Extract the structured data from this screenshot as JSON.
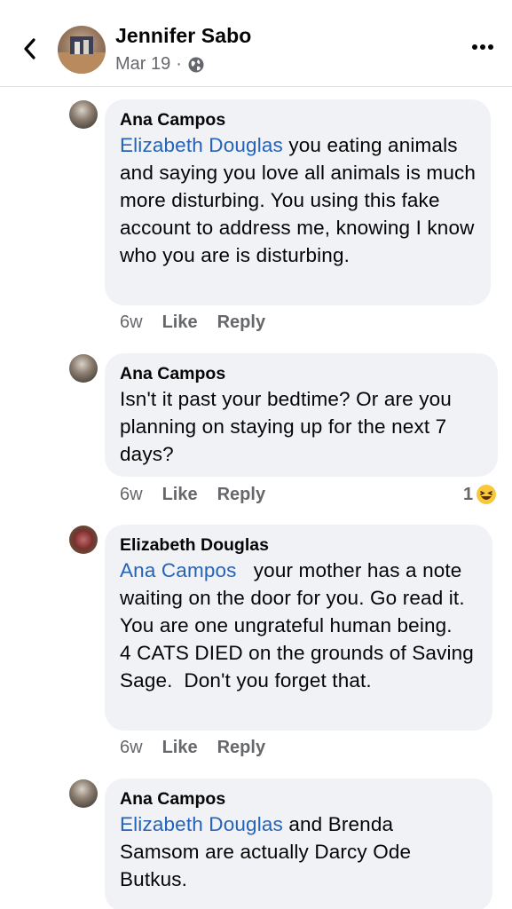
{
  "header": {
    "name": "Jennifer Sabo",
    "date": "Mar 19",
    "separator": "·"
  },
  "comments": [
    {
      "author": "Ana Campos",
      "mention": "Elizabeth Douglas",
      "text": " you eating animals and saying you love all animals is much more disturbing. You using this fake account to address me, knowing I know who you are is disturbing.",
      "time": "6w",
      "like": "Like",
      "reply": "Reply"
    },
    {
      "author": "Ana Campos",
      "mention": "",
      "text": "Isn't it past your bedtime? Or are you planning on staying up for the next 7 days?",
      "time": "6w",
      "like": "Like",
      "reply": "Reply",
      "reaction_count": "1"
    },
    {
      "author": "Elizabeth Douglas",
      "mention": "Ana Campos",
      "text": "   your mother has a note waiting on the door for you. Go read it.   You are one ungrateful human being.   4 CATS DIED on the grounds of Saving Sage.  Don't you forget that.",
      "time": "6w",
      "like": "Like",
      "reply": "Reply"
    },
    {
      "author": "Ana Campos",
      "mention": "Elizabeth Douglas",
      "text": " and Brenda Samsom are actually Darcy Ode Butkus."
    }
  ]
}
